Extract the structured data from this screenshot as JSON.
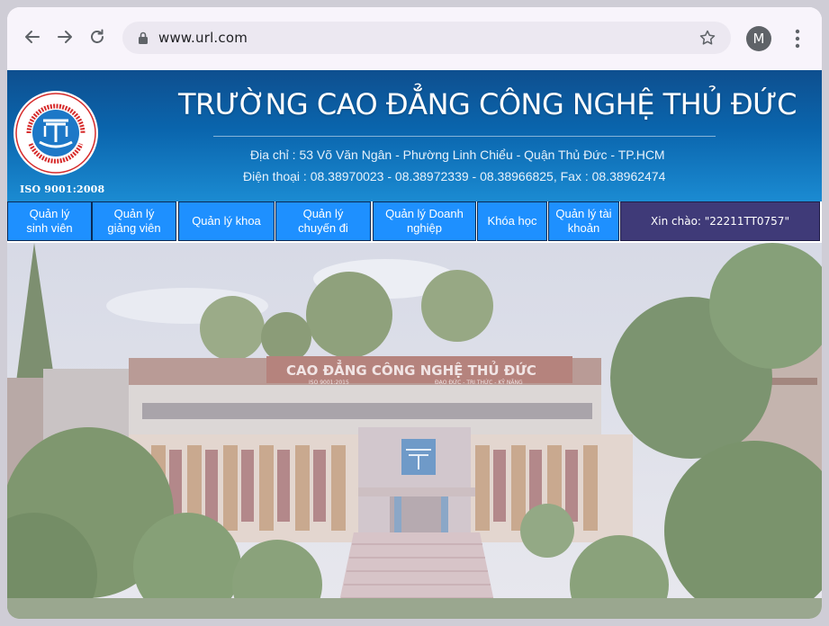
{
  "browser": {
    "url": "www.url.com",
    "profile_initial": "M"
  },
  "header": {
    "school_name": "TRƯỜNG CAO ĐẲNG CÔNG NGHỆ THỦ ĐỨC",
    "address": "Địa chỉ : 53 Võ Văn Ngân - Phường Linh Chiểu - Quận Thủ Đức - TP.HCM",
    "phone": "Điện thoại : 08.38970023 - 08.38972339 - 08.38966825, Fax : 08.38962474",
    "iso": "ISO 9001:2008"
  },
  "menu": {
    "items": [
      {
        "line1": "Quản lý",
        "line2": "sinh viên"
      },
      {
        "line1": "Quản lý",
        "line2": "giảng viên"
      },
      {
        "line1": "Quản lý khoa",
        "line2": ""
      },
      {
        "line1": "Quản lý",
        "line2": "chuyến đi"
      },
      {
        "line1": "Quản lý Doanh",
        "line2": "nghiệp"
      },
      {
        "line1": "Khóa học",
        "line2": ""
      },
      {
        "line1": "Quản lý tài",
        "line2": "khoản"
      }
    ],
    "greeting": "Xin chào: \"22211TT0757\""
  },
  "hero": {
    "building_sign": "CAO ĐẲNG CÔNG NGHỆ THỦ ĐỨC",
    "sign_iso": "ISO 9001:2015",
    "sign_motto": "ĐẠO ĐỨC - TRI THỨC - KỸ NĂNG"
  },
  "colors": {
    "banner": "#0a65ad",
    "menu": "#1e90ff",
    "greeting": "#3f3a78"
  }
}
